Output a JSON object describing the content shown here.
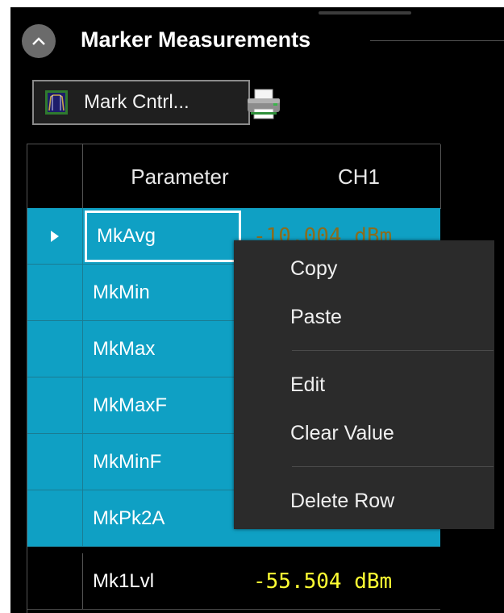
{
  "panel": {
    "title": "Marker Measurements"
  },
  "toolbar": {
    "mark_control_label": "Mark Cntrl...",
    "mark_control_icon": "marker-spectrum-icon",
    "print_icon": "printer-icon"
  },
  "grid": {
    "columns": [
      "Parameter",
      "CH1"
    ],
    "rows": [
      {
        "parameter": "MkAvg",
        "value": "-10.004 dBm",
        "selected": true,
        "current": true
      },
      {
        "parameter": "MkMin",
        "value": "",
        "selected": true
      },
      {
        "parameter": "MkMax",
        "value": "",
        "selected": true
      },
      {
        "parameter": "MkMaxF",
        "value": "",
        "selected": true
      },
      {
        "parameter": "MkMinF",
        "value": "",
        "selected": true
      },
      {
        "parameter": "MkPk2A",
        "value": "",
        "selected": true
      },
      {
        "parameter": "Mk1Lvl",
        "value": "-55.504 dBm",
        "selected": false
      }
    ]
  },
  "context_menu": {
    "items": [
      "Copy",
      "Paste",
      "Edit",
      "Clear Value",
      "Delete Row"
    ]
  },
  "colors": {
    "selection": "#0fa0c4",
    "value_text": "#ffff33",
    "menu_background": "#2b2b2b"
  }
}
